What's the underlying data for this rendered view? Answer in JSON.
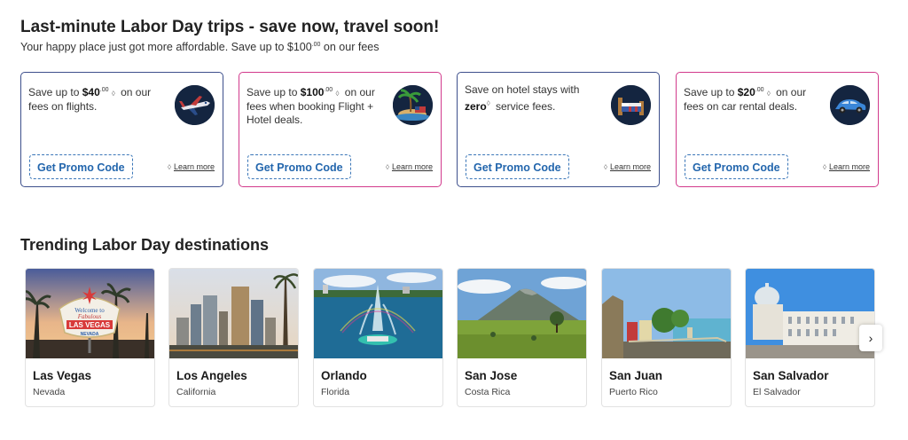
{
  "header": {
    "title": "Last-minute Labor Day trips - save now, travel soon!",
    "subtitle_pre": "Your happy place just got more affordable. Save up to $100",
    "subtitle_sup": ".00",
    "subtitle_post": " on our fees"
  },
  "promos": [
    {
      "style": "blue",
      "text_pre": "Save up to ",
      "amount": "$40",
      "amount_sup": ".00",
      "mark": "◊",
      "text_post": " on our fees on flights.",
      "icon": "airplane-icon",
      "button": "Get Promo Code",
      "learn": "Learn more"
    },
    {
      "style": "pink",
      "text_pre": "Save up to ",
      "amount": "$100",
      "amount_sup": ".00",
      "mark": "◊",
      "text_post": " on our fees when booking Flight + Hotel deals.",
      "icon": "island-icon",
      "button": "Get Promo Code",
      "learn": "Learn more"
    },
    {
      "style": "blue",
      "text_pre": "Save on hotel stays with ",
      "amount": "zero",
      "amount_sup": "",
      "mark": "◊",
      "text_post": " service fees.",
      "icon": "bed-icon",
      "button": "Get Promo Code",
      "learn": "Learn more"
    },
    {
      "style": "pink",
      "text_pre": "Save up to ",
      "amount": "$20",
      "amount_sup": ".00",
      "mark": "◊",
      "text_post": " on our fees on car rental deals.",
      "icon": "car-icon",
      "button": "Get Promo Code",
      "learn": "Learn more"
    }
  ],
  "trending": {
    "title": "Trending Labor Day destinations",
    "destinations": [
      {
        "name": "Las Vegas",
        "region": "Nevada",
        "sign_line1": "Welcome to",
        "sign_line2": "Fabulous",
        "sign_line3": "LAS VEGAS",
        "sign_line4": "NEVADA"
      },
      {
        "name": "Los Angeles",
        "region": "California"
      },
      {
        "name": "Orlando",
        "region": "Florida"
      },
      {
        "name": "San Jose",
        "region": "Costa Rica"
      },
      {
        "name": "San Juan",
        "region": "Puerto Rico"
      },
      {
        "name": "San Salvador",
        "region": "El Salvador"
      }
    ],
    "next_icon": "chevron-right-icon",
    "next_glyph": "›"
  },
  "colors": {
    "blue_border": "#3d4f8c",
    "pink_border": "#d23a8c",
    "link_blue": "#2366ad",
    "icon_bg": "#142540"
  }
}
